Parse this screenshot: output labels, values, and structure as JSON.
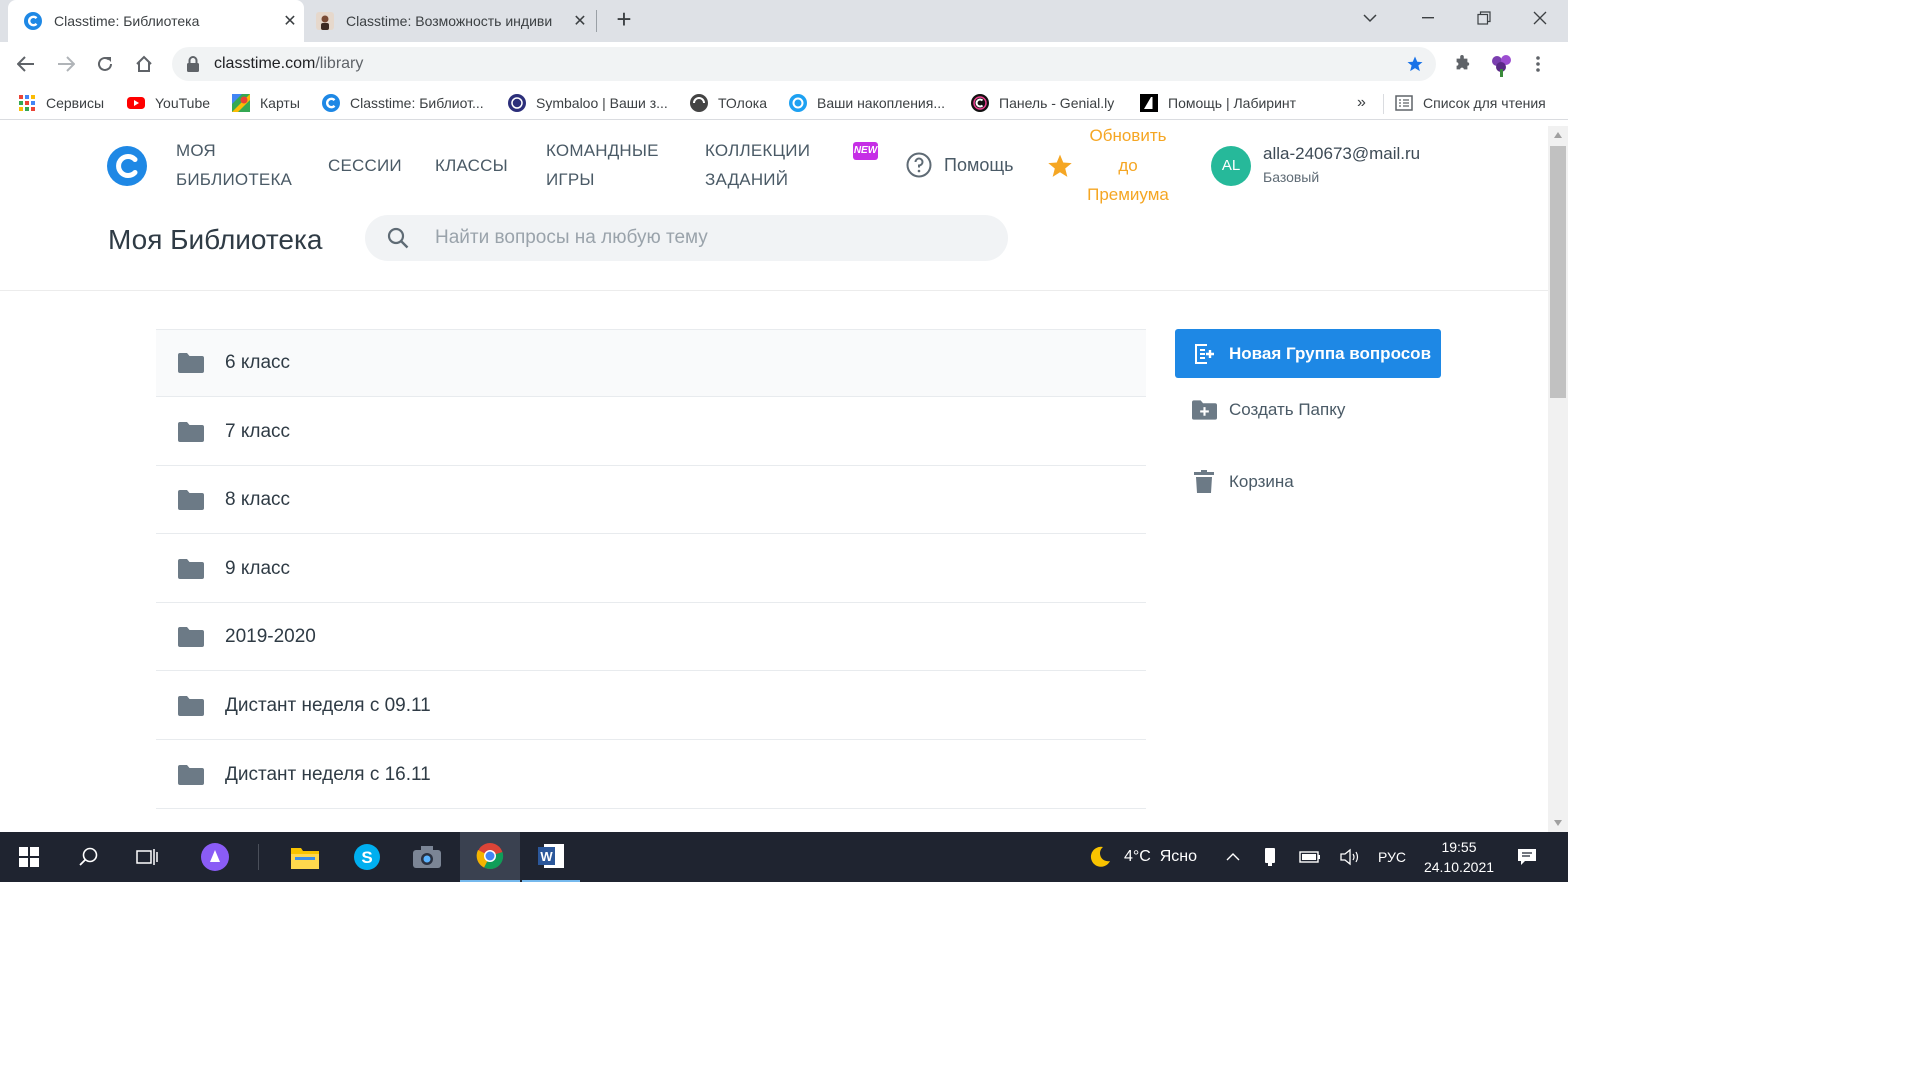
{
  "tabs": [
    {
      "title": "Classtime: Библиотека",
      "active": true
    },
    {
      "title": "Classtime: Возможность индиви",
      "active": false
    }
  ],
  "address": {
    "domain": "classtime.com",
    "path": "/library"
  },
  "bookmarks": [
    {
      "label": "Сервисы",
      "icon": "apps-grid-icon"
    },
    {
      "label": "YouTube",
      "icon": "youtube-icon"
    },
    {
      "label": "Карты",
      "icon": "maps-icon"
    },
    {
      "label": "Classtime: Библиот...",
      "icon": "classtime-icon"
    },
    {
      "label": "Symbaloo | Ваши з...",
      "icon": "symbaloo-icon"
    },
    {
      "label": "ТОлока",
      "icon": "toloka-icon"
    },
    {
      "label": "Ваши накопления...",
      "icon": "savings-icon"
    },
    {
      "label": "Панель - Genial.ly",
      "icon": "genially-icon"
    },
    {
      "label": "Помощь | Лабиринт",
      "icon": "labirint-icon"
    }
  ],
  "bookmarks_overflow": "»",
  "reading_list": "Список для чтения",
  "site": {
    "nav": [
      {
        "line1": "МОЯ",
        "line2": "БИБЛИОТЕКА"
      },
      {
        "line1": "СЕССИИ",
        "line2": ""
      },
      {
        "line1": "КЛАССЫ",
        "line2": ""
      },
      {
        "line1": "КОМАНДНЫЕ",
        "line2": "ИГРЫ"
      },
      {
        "line1": "КОЛЛЕКЦИИ",
        "line2": "ЗАДАНИЙ"
      }
    ],
    "new_badge": "NEW",
    "help": "Помощь",
    "upgrade": [
      "Обновить",
      "до",
      "Премиума"
    ],
    "user": {
      "initials": "AL",
      "email": "alla-240673@mail.ru",
      "plan": "Базовый"
    },
    "page_title": "Моя Библиотека",
    "search_placeholder": "Найти вопросы на любую тему"
  },
  "folders": [
    "6 класс",
    "7 класс",
    "8 класс",
    "9 класс",
    "2019-2020",
    "Дистант неделя с 09.11",
    "Дистант неделя с 16.11"
  ],
  "actions": {
    "new_group": "Новая Группа вопросов",
    "create_folder": "Создать Папку",
    "trash": "Корзина"
  },
  "taskbar": {
    "weather": "4°C  Ясно",
    "lang": "РУС",
    "time": "19:55",
    "date": "24.10.2021"
  },
  "colors": {
    "accent": "#1e88e5",
    "upgrade": "#f5a623",
    "avatar": "#26b99a",
    "new_badge": "#c62ee6"
  }
}
